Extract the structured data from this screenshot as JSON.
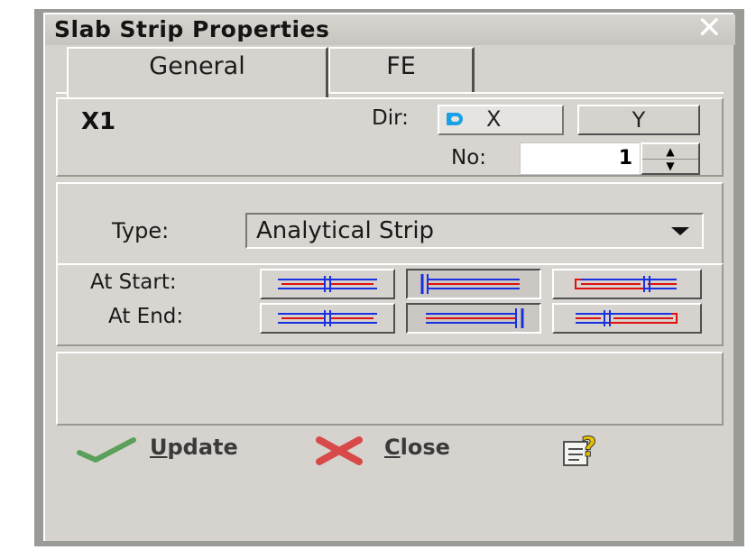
{
  "window": {
    "title": "Slab Strip Properties",
    "close_glyph": "✕"
  },
  "tabs": [
    {
      "label": "General",
      "active": true
    },
    {
      "label": "FE",
      "active": false
    }
  ],
  "strip": {
    "name": "X1",
    "dir_label": "Dir:",
    "dir_options": [
      "X",
      "Y"
    ],
    "dir_selected": "X",
    "no_label": "No:",
    "no_value": "1"
  },
  "type": {
    "label": "Type:",
    "selected": "Analytical Strip"
  },
  "end_conditions": {
    "start_label": "At Start:",
    "end_label": "At End:",
    "start_buttons": [
      "continuous-icon",
      "fixed-left-icon",
      "free-right-icon"
    ],
    "end_buttons": [
      "continuous-icon",
      "fixed-right-icon",
      "free-left-icon"
    ],
    "active_start": 1,
    "active_end": 1,
    "colors": {
      "red": "#e01010",
      "blue": "#1830e0"
    }
  },
  "actions": {
    "update_label": "Update",
    "close_label": "Close",
    "update_icon": "check-icon",
    "close_icon": "cross-icon",
    "help_icon": "help-icon"
  }
}
